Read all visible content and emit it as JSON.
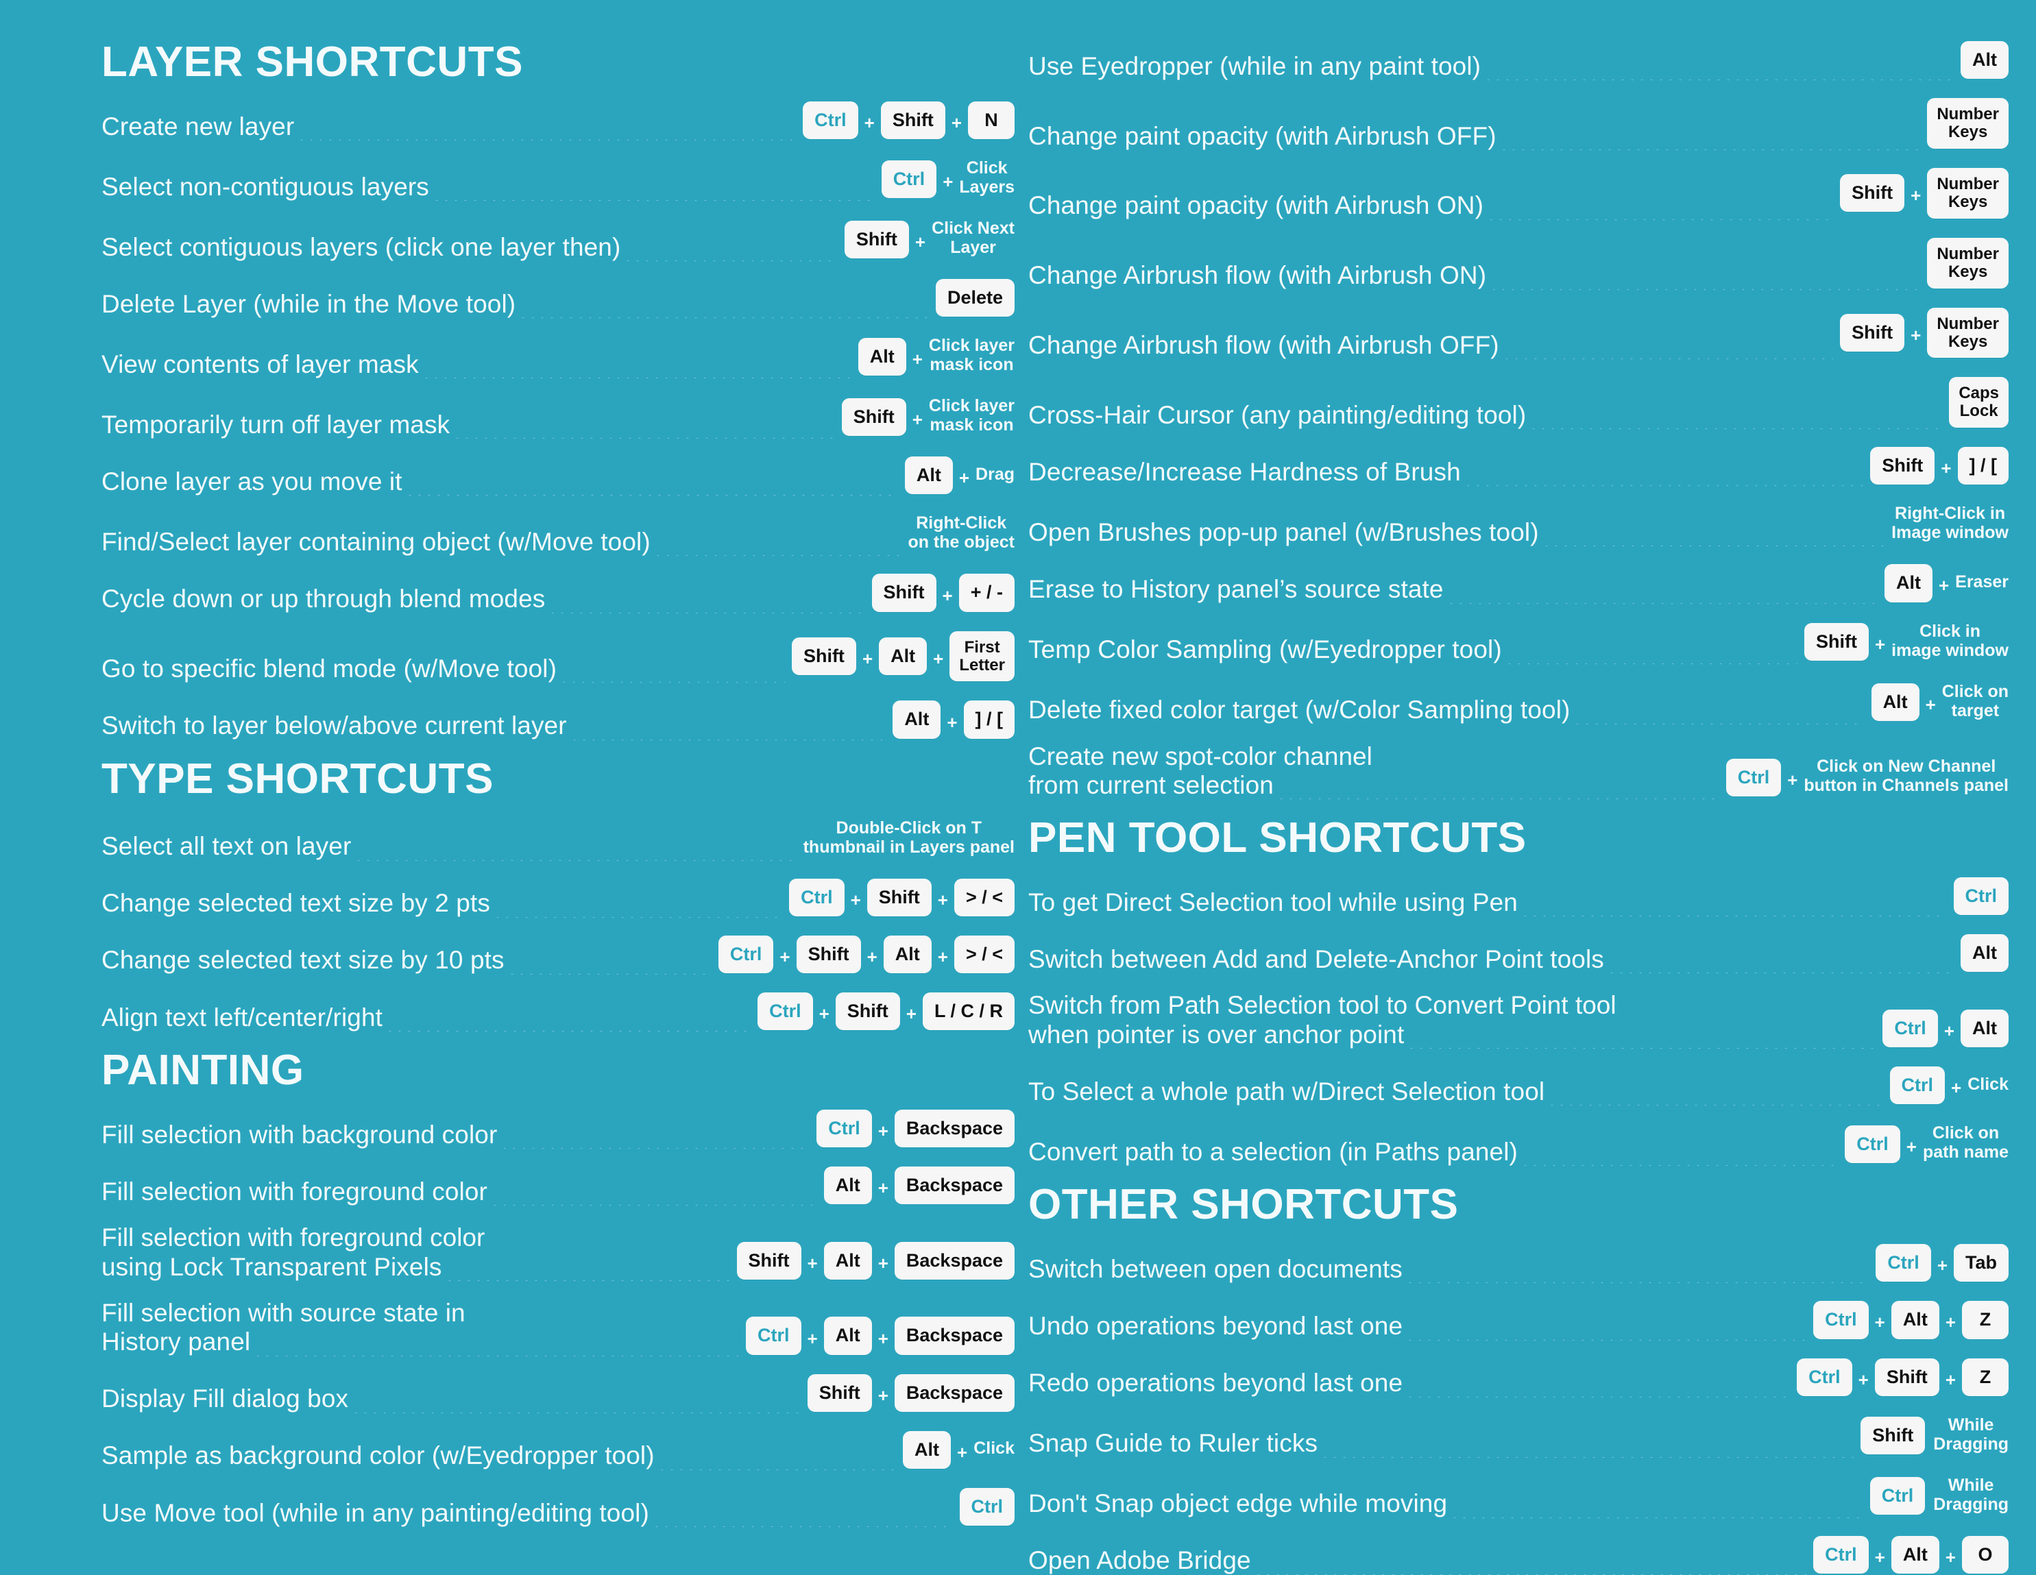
{
  "background_color": "#2BA5BE",
  "key_color": "#F6F6F6",
  "ctrl_key_color": "#2BA5BE",
  "text_color": "#F4FAFB",
  "sections": {
    "layer": {
      "title": "LAYER SHORTCUTS",
      "rows": [
        {
          "label": "Create new layer",
          "keys": [
            "Ctrl",
            "Shift",
            "N"
          ]
        },
        {
          "label": "Select non-contiguous layers",
          "keys": [
            "Ctrl"
          ],
          "note": "Click\nLayers"
        },
        {
          "label": "Select contiguous layers (click one layer then)",
          "keys": [
            "Shift"
          ],
          "note": "Click Next\nLayer"
        },
        {
          "label": "Delete Layer (while in the Move tool)",
          "keys": [
            "Delete"
          ]
        },
        {
          "label": "View contents of layer mask",
          "keys": [
            "Alt"
          ],
          "note": "Click layer\nmask icon"
        },
        {
          "label": "Temporarily turn off layer mask",
          "keys": [
            "Shift"
          ],
          "note": "Click layer\nmask icon"
        },
        {
          "label": "Clone layer as you move it",
          "keys": [
            "Alt"
          ],
          "note": "Drag"
        },
        {
          "label": "Find/Select layer containing object (w/Move tool)",
          "keys": [],
          "note_only": "Right-Click\non the object"
        },
        {
          "label": "Cycle down or up through blend modes",
          "keys": [
            "Shift",
            "+ / -"
          ]
        },
        {
          "label": "Go to specific blend mode (w/Move tool)",
          "keys": [
            "Shift",
            "Alt",
            "First\nLetter"
          ]
        },
        {
          "label": "Switch to layer below/above current layer",
          "keys": [
            "Alt",
            "] / ["
          ]
        }
      ]
    },
    "type": {
      "title": "TYPE SHORTCUTS",
      "rows": [
        {
          "label": "Select all text on layer",
          "keys": [],
          "note_only": "Double-Click on T\nthumbnail in Layers panel"
        },
        {
          "label": "Change selected text size by 2 pts",
          "keys": [
            "Ctrl",
            "Shift",
            "> / <"
          ]
        },
        {
          "label": "Change selected text size by 10 pts",
          "keys": [
            "Ctrl",
            "Shift",
            "Alt",
            "> / <"
          ]
        },
        {
          "label": "Align text left/center/right",
          "keys": [
            "Ctrl",
            "Shift",
            "L / C / R"
          ]
        }
      ]
    },
    "painting": {
      "title": "PAINTING",
      "rows": [
        {
          "label": "Fill selection with background color",
          "keys": [
            "Ctrl",
            "Backspace"
          ]
        },
        {
          "label": "Fill selection with foreground color",
          "keys": [
            "Alt",
            "Backspace"
          ]
        },
        {
          "label_line1": "Fill selection with foreground color",
          "label": "using Lock Transparent Pixels",
          "keys": [
            "Shift",
            "Alt",
            "Backspace"
          ]
        },
        {
          "label_line1": "Fill selection with source state in",
          "label": "History panel",
          "keys": [
            "Ctrl",
            "Alt",
            "Backspace"
          ]
        },
        {
          "label": "Display Fill dialog box",
          "keys": [
            "Shift",
            "Backspace"
          ]
        },
        {
          "label": "Sample as background color (w/Eyedropper tool)",
          "keys": [
            "Alt"
          ],
          "note": "Click"
        },
        {
          "label": "Use Move tool (while in any painting/editing tool)",
          "keys": [
            "Ctrl"
          ]
        }
      ]
    },
    "paint_top": {
      "rows": [
        {
          "label": "Use Eyedropper (while in any paint tool)",
          "keys": [
            "Alt"
          ]
        },
        {
          "label": "Change paint opacity (with Airbrush OFF)",
          "keys": [
            "Number\nKeys"
          ]
        },
        {
          "label": "Change paint opacity (with Airbrush ON)",
          "keys": [
            "Shift",
            "Number\nKeys"
          ]
        },
        {
          "label": "Change Airbrush flow (with Airbrush ON)",
          "keys": [
            "Number\nKeys"
          ]
        },
        {
          "label": "Change Airbrush flow (with Airbrush OFF)",
          "keys": [
            "Shift",
            "Number\nKeys"
          ]
        },
        {
          "label": "Cross-Hair Cursor (any painting/editing tool)",
          "keys": [
            "Caps\nLock"
          ]
        },
        {
          "label": "Decrease/Increase Hardness of Brush",
          "keys": [
            "Shift",
            "] / ["
          ]
        },
        {
          "label": "Open Brushes pop-up panel (w/Brushes tool)",
          "keys": [],
          "note_only": "Right-Click in\nImage window"
        },
        {
          "label": "Erase to History panel’s source state",
          "keys": [
            "Alt"
          ],
          "note": "Eraser"
        },
        {
          "label": "Temp Color Sampling (w/Eyedropper tool)",
          "keys": [
            "Shift"
          ],
          "note": "Click in\nimage window"
        },
        {
          "label": "Delete fixed color target (w/Color Sampling tool)",
          "keys": [
            "Alt"
          ],
          "note": "Click on\ntarget"
        },
        {
          "label_line1": "Create new spot-color channel",
          "label": "from current selection",
          "keys": [
            "Ctrl"
          ],
          "note": "Click on New Channel\nbutton in Channels panel"
        }
      ]
    },
    "pen": {
      "title": "PEN TOOL SHORTCUTS",
      "rows": [
        {
          "label": "To get Direct Selection tool while using Pen",
          "keys": [
            "Ctrl"
          ]
        },
        {
          "label": "Switch between Add and Delete-Anchor Point tools",
          "keys": [
            "Alt"
          ]
        },
        {
          "label_line1": "Switch from Path Selection tool to Convert Point tool",
          "label": "when pointer is over anchor point",
          "keys": [
            "Ctrl",
            "Alt"
          ]
        },
        {
          "label": "To Select a whole path w/Direct Selection tool",
          "keys": [
            "Ctrl"
          ],
          "note": "Click"
        },
        {
          "label": "Convert path to a selection (in Paths panel)",
          "keys": [
            "Ctrl"
          ],
          "note": "Click on\npath name"
        }
      ]
    },
    "other": {
      "title": "OTHER SHORTCUTS",
      "rows": [
        {
          "label": "Switch between open documents",
          "keys": [
            "Ctrl",
            "Tab"
          ]
        },
        {
          "label": "Undo operations beyond last one",
          "keys": [
            "Ctrl",
            "Alt",
            "Z"
          ]
        },
        {
          "label": "Redo operations beyond last one",
          "keys": [
            "Ctrl",
            "Shift",
            "Z"
          ]
        },
        {
          "label": "Snap Guide to Ruler ticks",
          "keys": [
            "Shift"
          ],
          "note_nosep": "While\nDragging"
        },
        {
          "label": "Don't Snap object edge while moving",
          "keys": [
            "Ctrl"
          ],
          "note_nosep": "While\nDragging"
        },
        {
          "label": "Open Adobe Bridge",
          "keys": [
            "Ctrl",
            "Alt",
            "O"
          ]
        }
      ]
    }
  }
}
